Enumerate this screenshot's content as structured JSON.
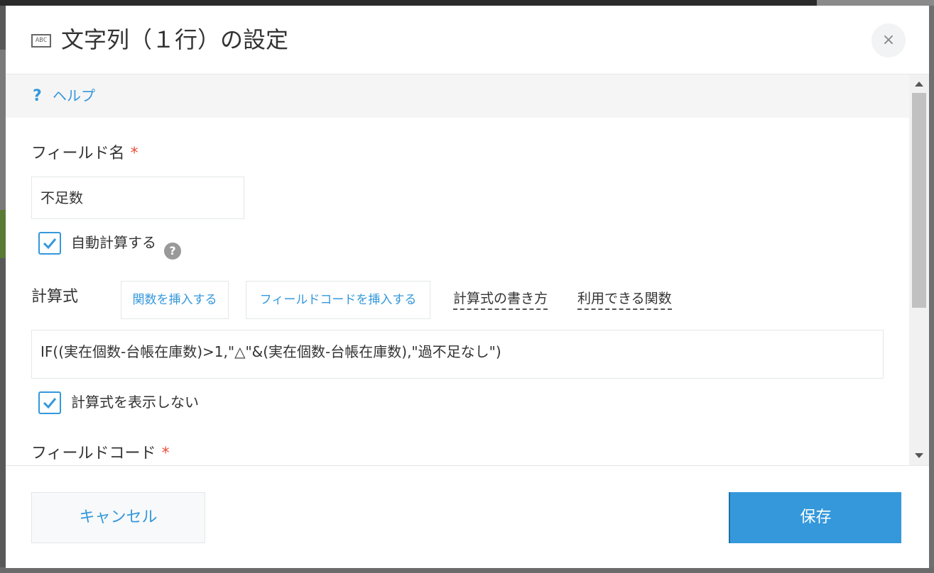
{
  "dialog": {
    "title": "文字列（１行）の設定",
    "title_icon_text": "ABC",
    "close_label": "×"
  },
  "help": {
    "icon": "?",
    "link_label": "ヘルプ"
  },
  "field_name": {
    "label": "フィールド名",
    "required_mark": "*",
    "value": "不足数"
  },
  "auto_calc": {
    "label": "自動計算する",
    "checked": true,
    "help_icon": "?"
  },
  "formula": {
    "label": "計算式",
    "insert_function_label": "関数を挿入する",
    "insert_field_code_label": "フィールドコードを挿入する",
    "how_to_write_label": "計算式の書き方",
    "available_functions_label": "利用できる関数",
    "value": "IF((実在個数-台帳在庫数)>1,\"△\"&(実在個数-台帳在庫数),\"過不足なし\")"
  },
  "hide_formula": {
    "label": "計算式を表示しない",
    "checked": true
  },
  "field_code": {
    "label": "フィールドコード",
    "required_mark": "*"
  },
  "footer": {
    "cancel_label": "キャンセル",
    "save_label": "保存"
  },
  "colors": {
    "accent": "#3498db",
    "required": "#e74c3c",
    "text": "#333333",
    "border": "#e3e7e8"
  }
}
